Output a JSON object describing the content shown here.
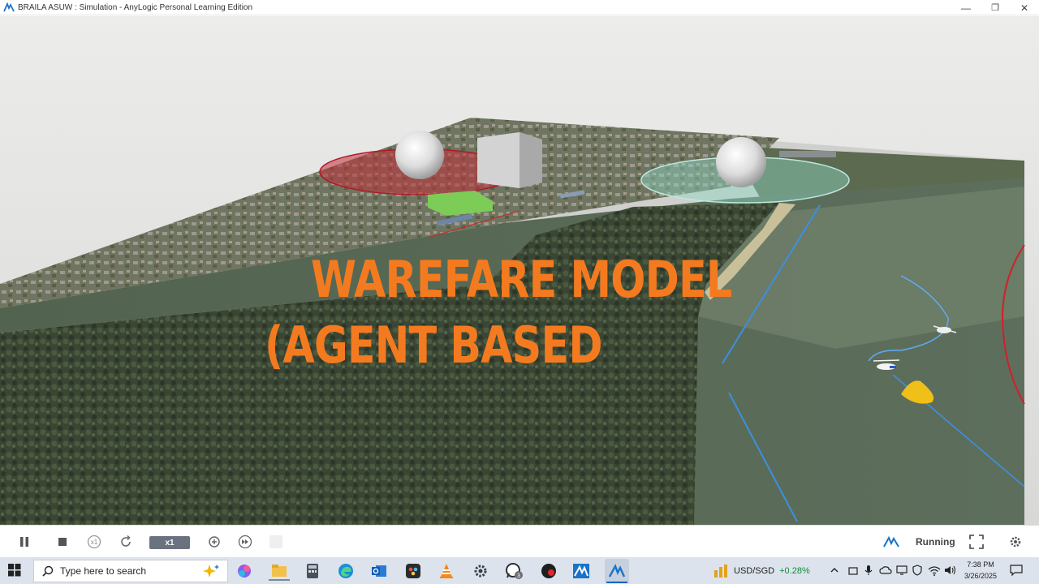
{
  "window": {
    "title": "BRAILA ASUW : Simulation - AnyLogic Personal Learning Edition",
    "controls": [
      "minimize-icon",
      "maximize-icon",
      "close-icon"
    ]
  },
  "scene": {
    "overlay_line1": "WAREFARE MODEL",
    "overlay_line2": "(AGENT BASED",
    "overlay_color": "#f47a20"
  },
  "controlbar": {
    "buttons": [
      "pause-icon",
      "stop-icon",
      "slower-icon",
      "refresh-icon",
      "faster-icon",
      "fast-forward-icon"
    ],
    "slower_label": "x1",
    "speed": "x1",
    "status": "Running"
  },
  "taskbar": {
    "search_placeholder": "Type here to search",
    "apps": [
      "copilot-icon",
      "file-explorer-icon",
      "calculator-icon",
      "edge-icon",
      "outlook-icon",
      "davinci-icon",
      "vlc-icon",
      "settings-icon",
      "whatsapp-icon",
      "media-icon",
      "anylogic-icon",
      "anylogic-active-icon"
    ],
    "whatsapp_badge": "3",
    "ticker_symbol": "USD/SGD",
    "ticker_change": "+0.28%",
    "time": "7:38 PM",
    "date": "3/26/2025"
  }
}
